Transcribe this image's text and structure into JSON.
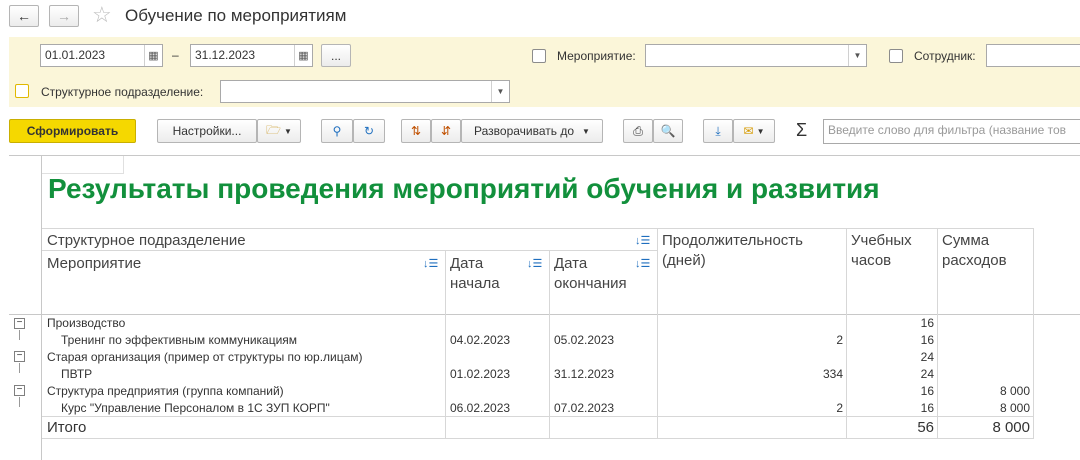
{
  "title": "Обучение по мероприятиям",
  "filters": {
    "date_from": "01.01.2023",
    "date_to": "31.12.2023",
    "date_dash": "–",
    "ellipsis": "...",
    "event_label": "Мероприятие:",
    "employee_label": "Сотрудник:",
    "dept_label": "Структурное подразделение:"
  },
  "toolbar": {
    "generate": "Сформировать",
    "settings": "Настройки...",
    "expand_to": "Разворачивать до",
    "search_placeholder": "Введите слово для фильтра (название тов"
  },
  "report": {
    "title": "Результаты проведения мероприятий обучения и развития",
    "headers": {
      "dept": "Структурное подразделение",
      "event": "Мероприятие",
      "date_start": "Дата начала",
      "date_end": "Дата окончания",
      "duration": "Продолжительность (дней)",
      "hours": "Учебных часов",
      "cost": "Сумма расходов"
    },
    "rows": [
      {
        "type": "group",
        "name": "Производство",
        "date_start": "",
        "date_end": "",
        "duration": "",
        "hours": "16",
        "cost": ""
      },
      {
        "type": "item",
        "name": "Тренинг по эффективным коммуникациям",
        "date_start": "04.02.2023",
        "date_end": "05.02.2023",
        "duration": "2",
        "hours": "16",
        "cost": ""
      },
      {
        "type": "group",
        "name": "Старая организация (пример от структуры по юр.лицам)",
        "date_start": "",
        "date_end": "",
        "duration": "",
        "hours": "24",
        "cost": ""
      },
      {
        "type": "item",
        "name": "ПВТР",
        "date_start": "01.02.2023",
        "date_end": "31.12.2023",
        "duration": "334",
        "hours": "24",
        "cost": ""
      },
      {
        "type": "group",
        "name": "Структура предприятия (группа компаний)",
        "date_start": "",
        "date_end": "",
        "duration": "",
        "hours": "16",
        "cost": "8 000"
      },
      {
        "type": "item",
        "name": "Курс \"Управление Персоналом в 1С ЗУП КОРП\"",
        "date_start": "06.02.2023",
        "date_end": "07.02.2023",
        "duration": "2",
        "hours": "16",
        "cost": "8 000"
      }
    ],
    "total": {
      "label": "Итого",
      "hours": "56",
      "cost": "8 000"
    }
  },
  "colors": {
    "accent": "#f5d800",
    "title_green": "#12903c",
    "filter_bg": "#fbf6d9"
  }
}
